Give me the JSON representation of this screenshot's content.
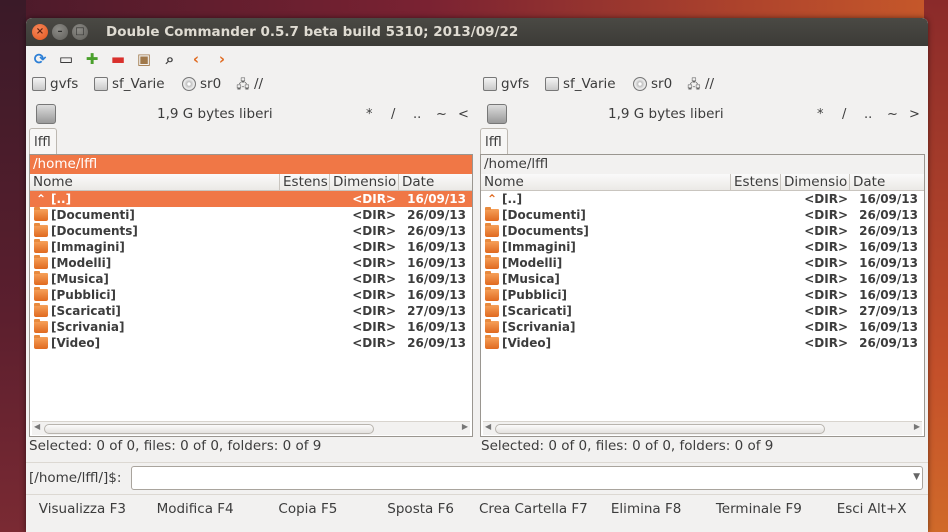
{
  "window": {
    "title": "Double Commander 0.5.7 beta build 5310; 2013/09/22"
  },
  "toolbar": [
    {
      "name": "refresh-icon",
      "glyph": "⟳",
      "color": "#2c7fd6"
    },
    {
      "name": "terminal-icon",
      "glyph": "▭",
      "color": "#222222"
    },
    {
      "name": "add-icon",
      "glyph": "✚",
      "color": "#4aa02c"
    },
    {
      "name": "remove-icon",
      "glyph": "▬",
      "color": "#d9302c"
    },
    {
      "name": "archive-icon",
      "glyph": "▣",
      "color": "#a0784a"
    },
    {
      "name": "search-icon",
      "glyph": "⌕",
      "color": "#444444"
    },
    {
      "name": "back-icon",
      "glyph": "‹",
      "color": "#e06a20"
    },
    {
      "name": "forward-icon",
      "glyph": "›",
      "color": "#e06a20"
    }
  ],
  "drives": [
    "gvfs",
    "sf_Varie",
    "sr0",
    "//"
  ],
  "left": {
    "free_space": "1,9 G bytes liberi",
    "nav": [
      "*",
      "/",
      "..",
      "~",
      "<"
    ],
    "tab": "lffl",
    "path": "/home/lffl",
    "columns": [
      "Nome",
      "Estens",
      "Dimensio",
      "Date"
    ],
    "status": "Selected: 0 of 0, files: 0 of 0, folders: 0 of 9"
  },
  "right": {
    "free_space": "1,9 G bytes liberi",
    "nav": [
      "*",
      "/",
      "..",
      "~",
      ">"
    ],
    "tab": "lffl",
    "path": "/home/lffl",
    "columns": [
      "Nome",
      "Estens",
      "Dimensio",
      "Date"
    ],
    "status": "Selected: 0 of 0, files: 0 of 0, folders: 0 of 9"
  },
  "files": [
    {
      "name": "[..]",
      "size": "<DIR>",
      "date": "16/09/13"
    },
    {
      "name": "[Documenti]",
      "size": "<DIR>",
      "date": "26/09/13"
    },
    {
      "name": "[Documents]",
      "size": "<DIR>",
      "date": "26/09/13"
    },
    {
      "name": "[Immagini]",
      "size": "<DIR>",
      "date": "16/09/13"
    },
    {
      "name": "[Modelli]",
      "size": "<DIR>",
      "date": "16/09/13"
    },
    {
      "name": "[Musica]",
      "size": "<DIR>",
      "date": "16/09/13"
    },
    {
      "name": "[Pubblici]",
      "size": "<DIR>",
      "date": "16/09/13"
    },
    {
      "name": "[Scaricati]",
      "size": "<DIR>",
      "date": "27/09/13"
    },
    {
      "name": "[Scrivania]",
      "size": "<DIR>",
      "date": "16/09/13"
    },
    {
      "name": "[Video]",
      "size": "<DIR>",
      "date": "26/09/13"
    }
  ],
  "cmdline": {
    "label": "[/home/lffl/]$:",
    "value": ""
  },
  "fkeys": [
    "Visualizza F3",
    "Modifica F4",
    "Copia F5",
    "Sposta F6",
    "Crea Cartella F7",
    "Elimina F8",
    "Terminale F9",
    "Esci Alt+X"
  ],
  "colors": {
    "accent": "#f07746",
    "titlebar": "#3c3b37"
  }
}
